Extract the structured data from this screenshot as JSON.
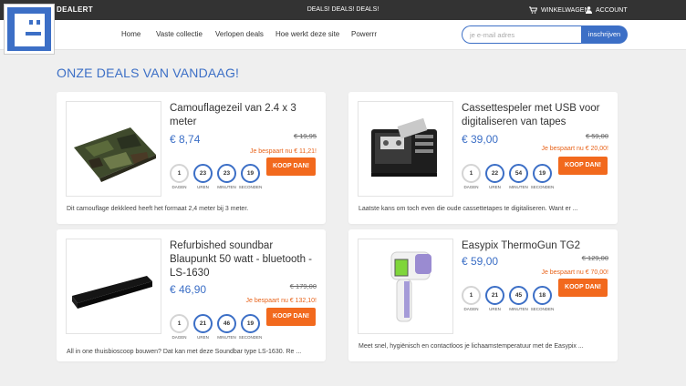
{
  "topbar": {
    "brand": "DEALERT",
    "promo": "DEALS! DEALS! DEALS!",
    "cart_label": "WINKELWAGEN",
    "account_label": "ACCOUNT"
  },
  "nav": {
    "items": [
      "Home",
      "Vaste collectie",
      "Verlopen deals",
      "Hoe werkt deze site",
      "Powerrr"
    ]
  },
  "newsletter": {
    "placeholder": "je e-mail adres",
    "button_label": "inschrijven"
  },
  "section_title": "ONZE DEALS VAN VANDAAG!",
  "timer_labels": [
    "DAGEN",
    "UREN",
    "MINUTEN",
    "SECONDEN"
  ],
  "deal_button_label": "KOOP DAN!",
  "deals": [
    {
      "title": "Camouflagezeil van 2.4 x 3 meter",
      "price": "€ 8,74",
      "old_price": "€ 19,95",
      "saved": "Je bespaart nu € 11,21!",
      "timer": [
        "1",
        "23",
        "23",
        "19"
      ],
      "description": "Dit camouflage dekkleed heeft het formaat 2,4 meter bij 3 meter."
    },
    {
      "title": "Cassettespeler met USB voor digitaliseren van tapes",
      "price": "€ 39,00",
      "old_price": "€ 59,00",
      "saved": "Je bespaart nu € 20,00!",
      "timer": [
        "1",
        "22",
        "54",
        "19"
      ],
      "description": "Laatste kans om toch even die oude cassettetapes te digitaliseren. Want er ..."
    },
    {
      "title": "Refurbished soundbar Blaupunkt 50 watt - bluetooth - LS-1630",
      "price": "€ 46,90",
      "old_price": "€ 179,00",
      "saved": "Je bespaart nu € 132,10!",
      "timer": [
        "1",
        "21",
        "46",
        "19"
      ],
      "description": "All in one thuisbioscoop bouwen? Dat kan met deze Soundbar type LS-1630. Re ..."
    },
    {
      "title": "Easypix ThermoGun TG2",
      "price": "€ 59,00",
      "old_price": "€ 129,00",
      "saved": "Je bespaart nu € 70,00!",
      "timer": [
        "1",
        "21",
        "45",
        "18"
      ],
      "description": "Meet snel, hygiënisch en contactloos je lichaamstemperatuur met de Easypix ..."
    }
  ],
  "colors": {
    "accent": "#3c6fc6",
    "button": "#f2691d",
    "topbar": "#333333",
    "background": "#efefef"
  }
}
